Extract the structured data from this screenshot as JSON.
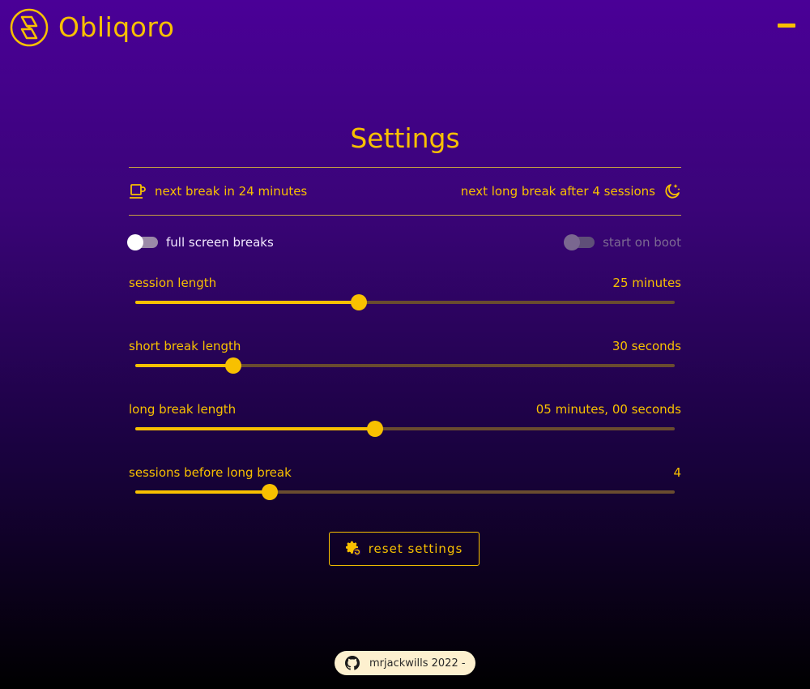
{
  "app": {
    "title": "Obliqoro",
    "accent": "#f8c000"
  },
  "page": {
    "title": "Settings"
  },
  "info": {
    "next_break": "next break in 24 minutes",
    "next_long_break": "next long break after 4 sessions"
  },
  "toggles": [
    {
      "label": "full screen breaks",
      "on": false,
      "enabled": true
    },
    {
      "label": "start on boot",
      "on": false,
      "enabled": false
    }
  ],
  "sliders": [
    {
      "label": "session length",
      "value": "25 minutes",
      "fraction": 0.414
    },
    {
      "label": "short break length",
      "value": "30 seconds",
      "fraction": 0.182
    },
    {
      "label": "long break length",
      "value": "05 minutes, 00 seconds",
      "fraction": 0.444
    },
    {
      "label": "sessions before long break",
      "value": "4",
      "fraction": 0.249
    }
  ],
  "reset": {
    "label": "reset settings"
  },
  "footer": {
    "label": "mrjackwills 2022 -"
  }
}
